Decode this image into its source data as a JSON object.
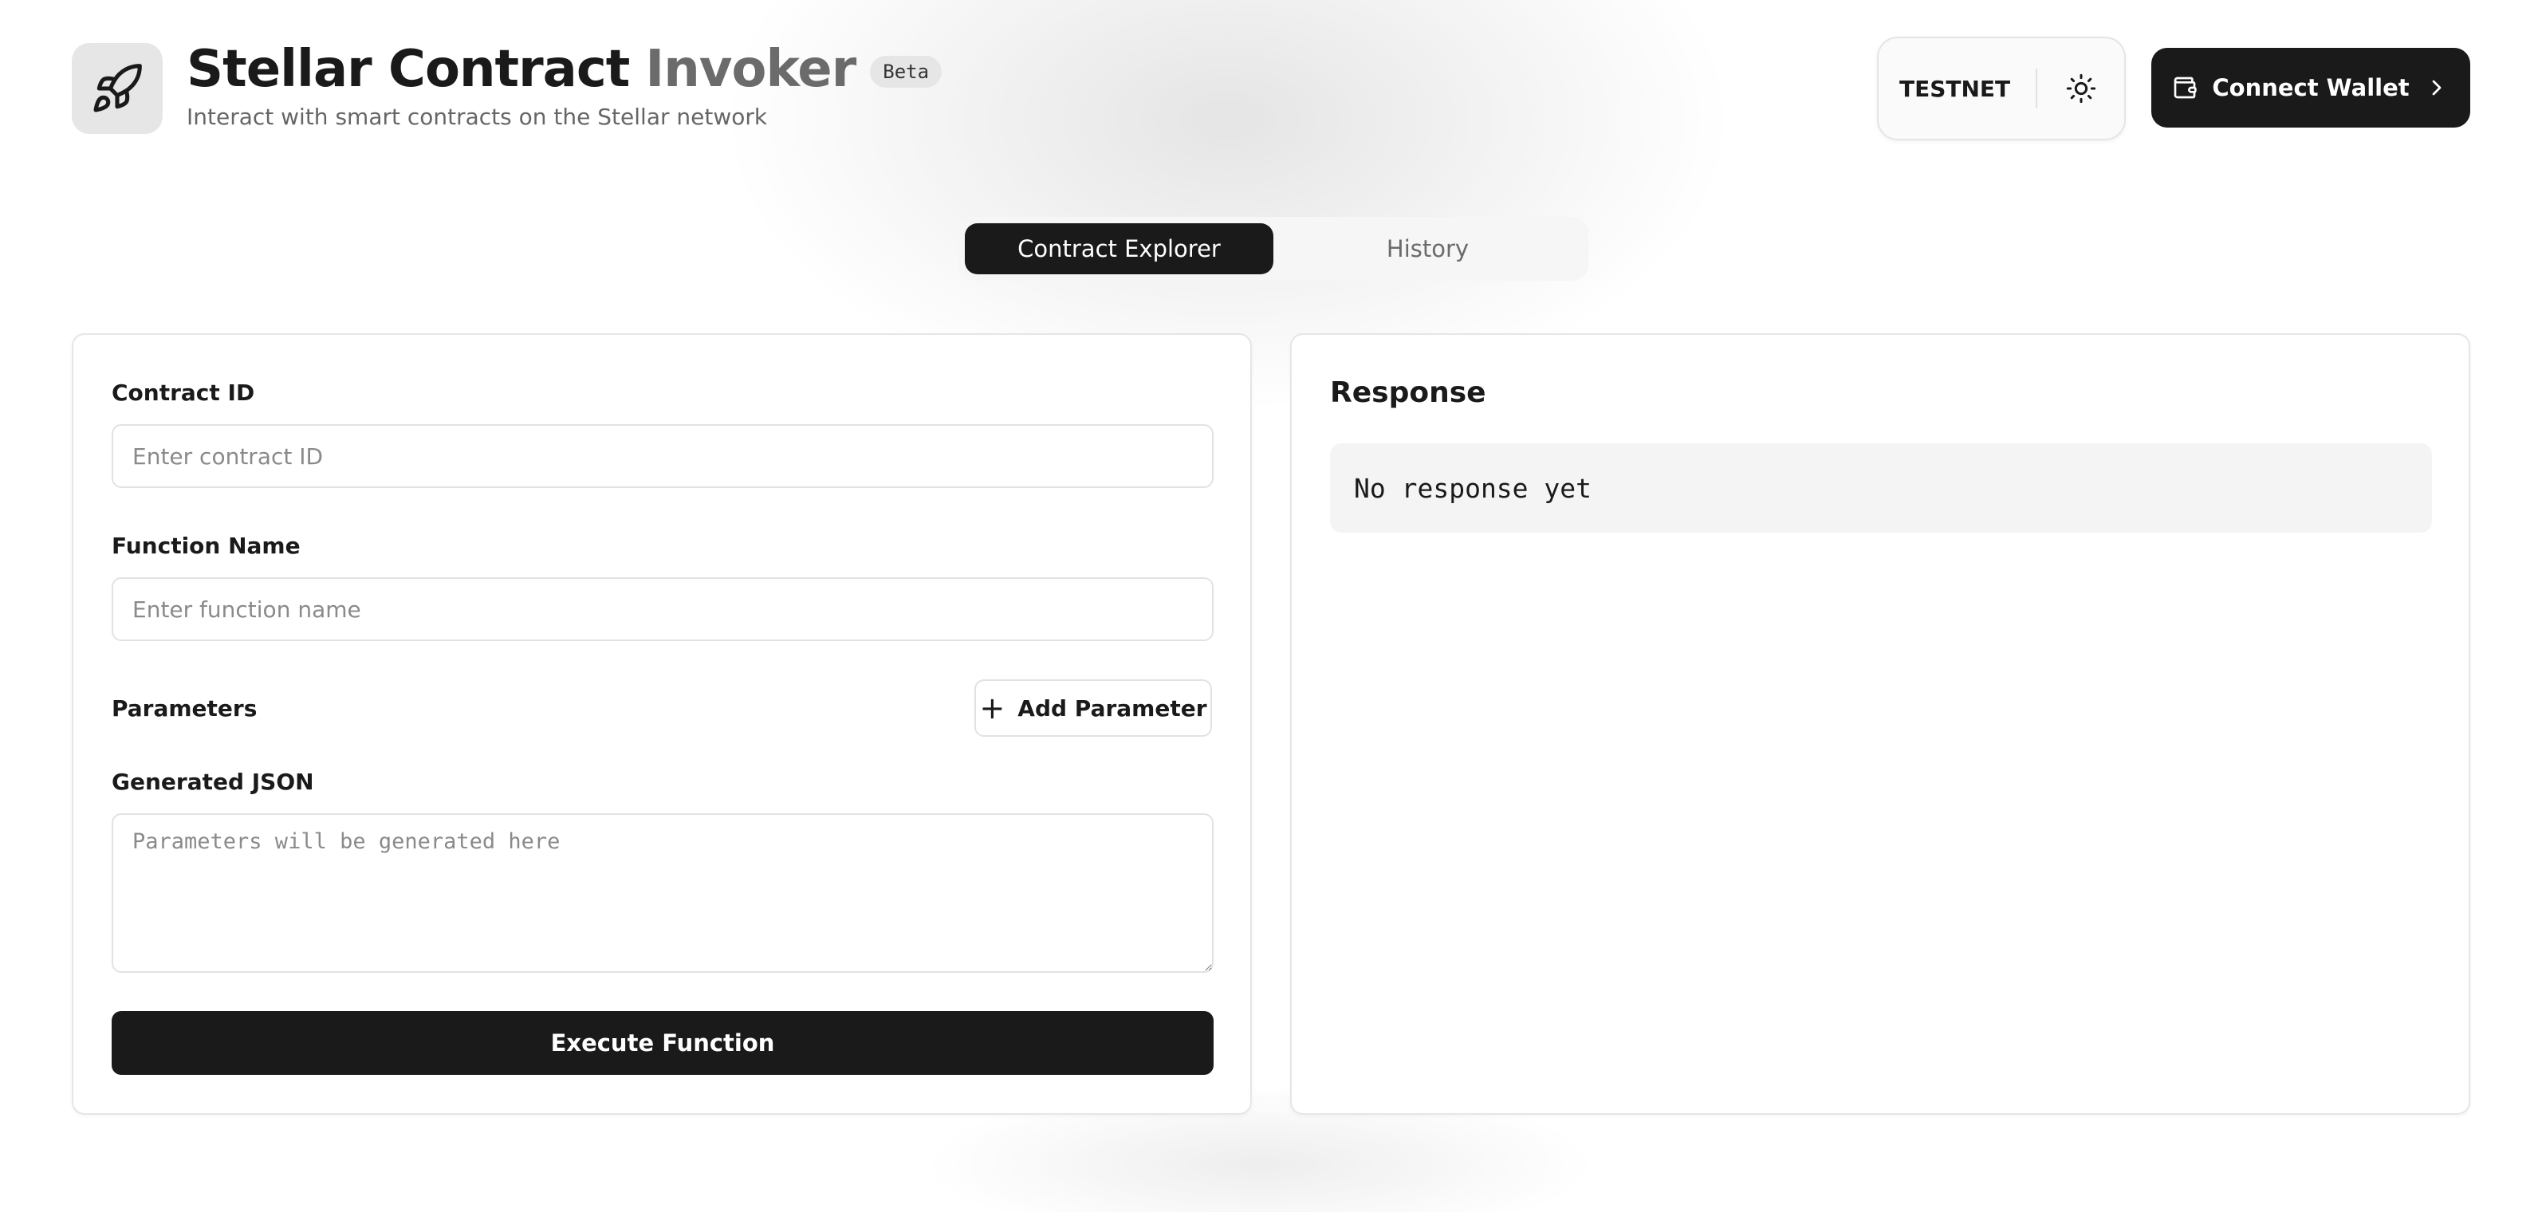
{
  "header": {
    "logo_icon": "rocket-icon",
    "title_primary": "Stellar Contract",
    "title_secondary": "Invoker",
    "badge": "Beta",
    "subtitle": "Interact with smart contracts on the Stellar network",
    "network": "TESTNET",
    "theme_icon": "sun-icon",
    "connect_wallet_label": "Connect Wallet",
    "wallet_icon": "wallet-icon",
    "chevron_icon": "chevron-right-icon"
  },
  "tabs": [
    {
      "label": "Contract Explorer",
      "active": true
    },
    {
      "label": "History",
      "active": false
    }
  ],
  "form": {
    "contract_id_label": "Contract ID",
    "contract_id_placeholder": "Enter contract ID",
    "contract_id_value": "",
    "function_name_label": "Function Name",
    "function_name_placeholder": "Enter function name",
    "function_name_value": "",
    "parameters_label": "Parameters",
    "add_parameter_label": "Add Parameter",
    "generated_json_label": "Generated JSON",
    "generated_json_placeholder": "Parameters will be generated here",
    "execute_label": "Execute Function"
  },
  "response": {
    "title": "Response",
    "text": "No response yet"
  },
  "colors": {
    "primary": "#1a1a1a",
    "muted_text": "#6b6b6b",
    "border": "#e2e2e2",
    "surface": "#f4f4f4"
  }
}
